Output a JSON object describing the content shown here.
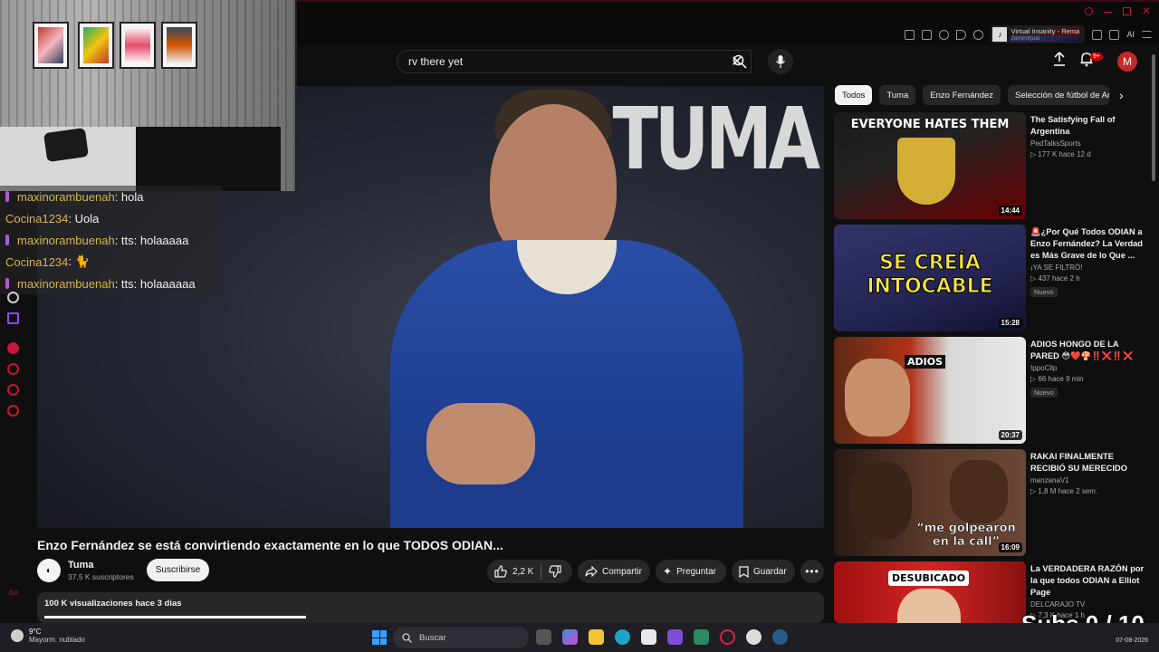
{
  "browser": {
    "media_title": "Virtual Insanity - Rema",
    "media_artist": "Jamiroquai",
    "ai_label": "AI"
  },
  "header": {
    "search_query": "rv there yet",
    "notification_count": "9+",
    "avatar_letter": "M"
  },
  "chat": [
    {
      "user": "maxinorambuenah",
      "text": " : hola",
      "style": "u1",
      "pip": true
    },
    {
      "user": "Cocina1234",
      "text": " : Uola",
      "style": "u2",
      "pip": false
    },
    {
      "user": "maxinorambuenah",
      "text": " : tts: holaaaaa",
      "style": "u1",
      "pip": true
    },
    {
      "user": "Cocina1234",
      "text": " : 🐈",
      "style": "u2",
      "pip": false
    },
    {
      "user": "maxinorambuenah",
      "text": " : tts: holaaaaaa",
      "style": "u1",
      "pip": true
    }
  ],
  "player": {
    "overlay_text": "TUMA"
  },
  "video": {
    "title": "Enzo Fernández se está convirtiendo exactamente en lo que TODOS ODIAN...",
    "channel": "Tuma",
    "subscribers": "37,5 K suscriptores",
    "subscribe_label": "Suscribirse",
    "likes": "2,2 K",
    "share_label": "Compartir",
    "ask_label": "Preguntar",
    "save_label": "Guardar",
    "views_date": "100 K visualizaciones  hace 3 días",
    "progress": 0.34
  },
  "chips": [
    "Todos",
    "Tuma",
    "Enzo Fernández",
    "Selección de fútbol de Argentina"
  ],
  "recommendations": [
    {
      "title": "The Satisfying Fall of Argentina",
      "channel": "PedTalksSports",
      "stats": "▷ 177 K  hace 12 d",
      "duration": "14:44",
      "badge": "",
      "thumb_text": "EVERYONE HATES THEM"
    },
    {
      "title": "🚨¿Por Qué Todos ODIAN a Enzo Fernández? La Verdad es Más Grave de lo Que ...",
      "channel": "¡YA SE FILTRÓ!",
      "stats": "▷ 437  hace 2 h",
      "duration": "15:28",
      "badge": "Nuevo",
      "thumb_text": "SE CREÍA INTOCABLE"
    },
    {
      "title": "ADIOS HONGO DE LA PARED 😳❤️🍄‼️❌‼️❌",
      "channel": "IppoClip",
      "stats": "▷ 66  hace 9 min",
      "duration": "20:37",
      "badge": "Nuevo",
      "thumb_text": "ADIOS"
    },
    {
      "title": "RAKAI FINALMENTE RECIBIÓ SU MERECIDO",
      "channel": "manzanaV1",
      "stats": "▷ 1,8 M  hace 2 sem.",
      "duration": "16:09",
      "badge": "",
      "thumb_text": "“me golpearon en la call”"
    },
    {
      "title": "La VERDADERA RAZÓN por la que todos ODIAN a Elliot Page",
      "channel": "DELCARAJO TV",
      "stats": "▷ 7,3 K  hace 1 h",
      "duration": "",
      "badge": "",
      "thumb_text": "DESUBICADO"
    }
  ],
  "overlay": {
    "subs": "Subs 0 / 10"
  },
  "taskbar": {
    "temp": "9°C",
    "condition": "Mayorm. nublado",
    "search": "Buscar",
    "date": "07-08-2026"
  }
}
